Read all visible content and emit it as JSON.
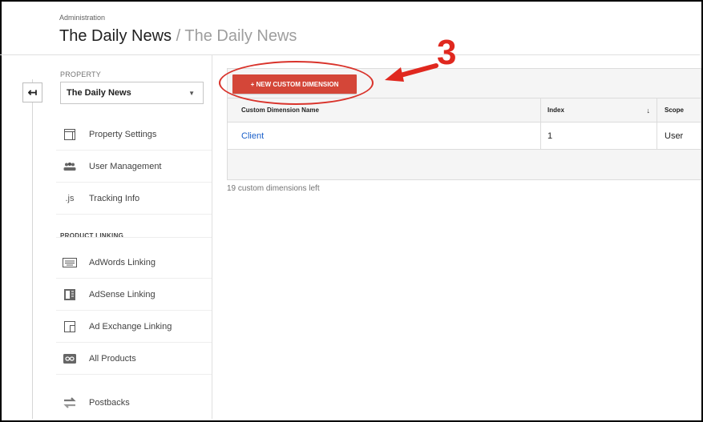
{
  "header": {
    "admin_label": "Administration",
    "title_main": "The Daily News",
    "title_sub": "/ The Daily News"
  },
  "sidebar": {
    "property_label": "PROPERTY",
    "property_value": "The Daily News",
    "items_top": [
      {
        "label": "Property Settings",
        "icon": "window-icon"
      },
      {
        "label": "User Management",
        "icon": "users-icon"
      },
      {
        "label": "Tracking Info",
        "icon": "js-icon",
        "icon_text": ".js"
      }
    ],
    "section_label": "PRODUCT LINKING",
    "items_linking": [
      {
        "label": "AdWords Linking",
        "icon": "keyboard-icon"
      },
      {
        "label": "AdSense Linking",
        "icon": "adsense-icon"
      },
      {
        "label": "Ad Exchange Linking",
        "icon": "ad-exchange-icon"
      },
      {
        "label": "All Products",
        "icon": "link-icon"
      }
    ],
    "postbacks_label": "Postbacks"
  },
  "main": {
    "new_button_label": "+ NEW CUSTOM DIMENSION",
    "columns": [
      "Custom Dimension Name",
      "Index",
      "Scope"
    ],
    "rows": [
      {
        "name": "Client",
        "index": "1",
        "scope": "User"
      }
    ],
    "remaining_text": "19 custom dimensions left"
  },
  "annotation": {
    "step_number": "3",
    "color": "#e0281f"
  },
  "colors": {
    "primary_button": "#d44638",
    "link": "#1a5fc9"
  }
}
